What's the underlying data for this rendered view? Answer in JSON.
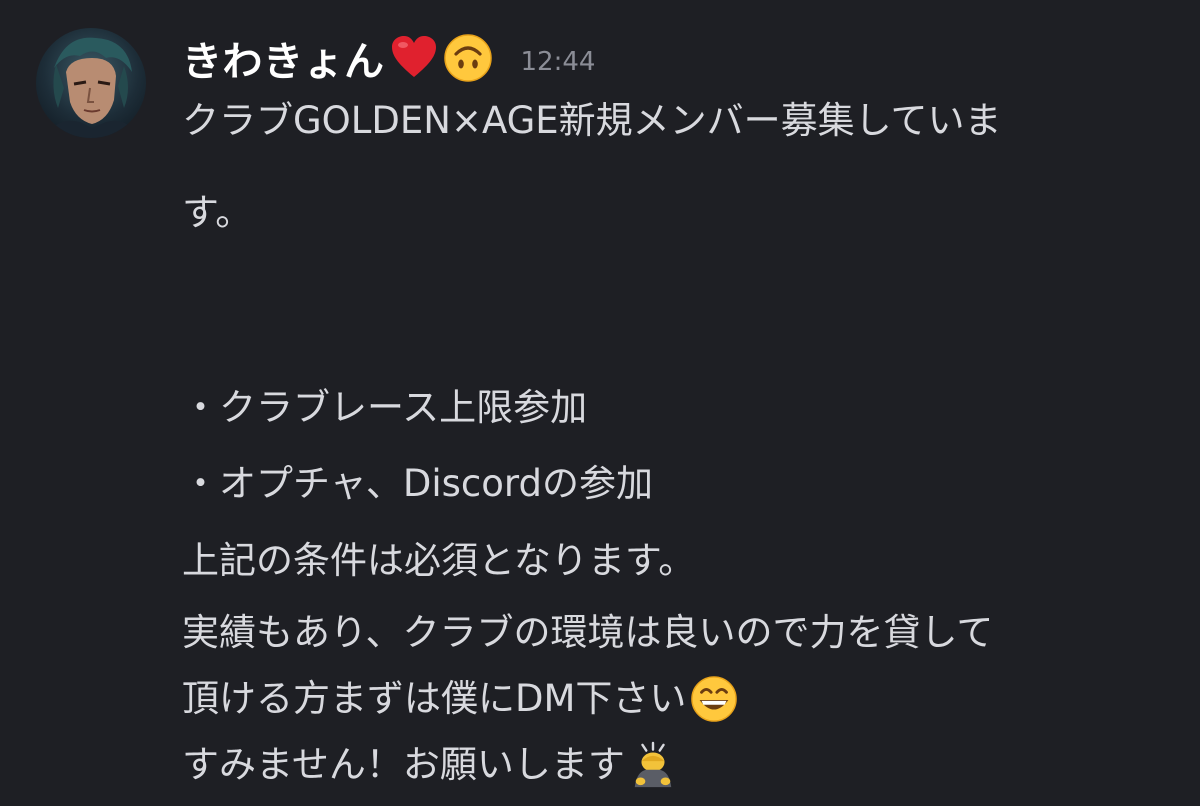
{
  "message": {
    "author": "きわきょん",
    "author_emojis": [
      "heart-emoji",
      "upside-down-face-emoji"
    ],
    "timestamp": "12:44",
    "lines": [
      "クラブGOLDEN×AGE新規メンバー募集していま",
      "す。",
      "",
      "・クラブレース上限参加",
      "・オプチャ、Discordの参加",
      "上記の条件は必須となります。",
      "実績もあり、クラブの環境は良いので力を貸して",
      "頂ける方まずは僕にDM下さい",
      "すみません！お願いします"
    ],
    "line_emojis": {
      "7": "grinning-face-emoji",
      "8": "person-bowing-emoji"
    }
  },
  "colors": {
    "background": "#1e1f24",
    "author": "#ffffff",
    "text": "#d8d9de",
    "timestamp": "#8b8d96"
  }
}
